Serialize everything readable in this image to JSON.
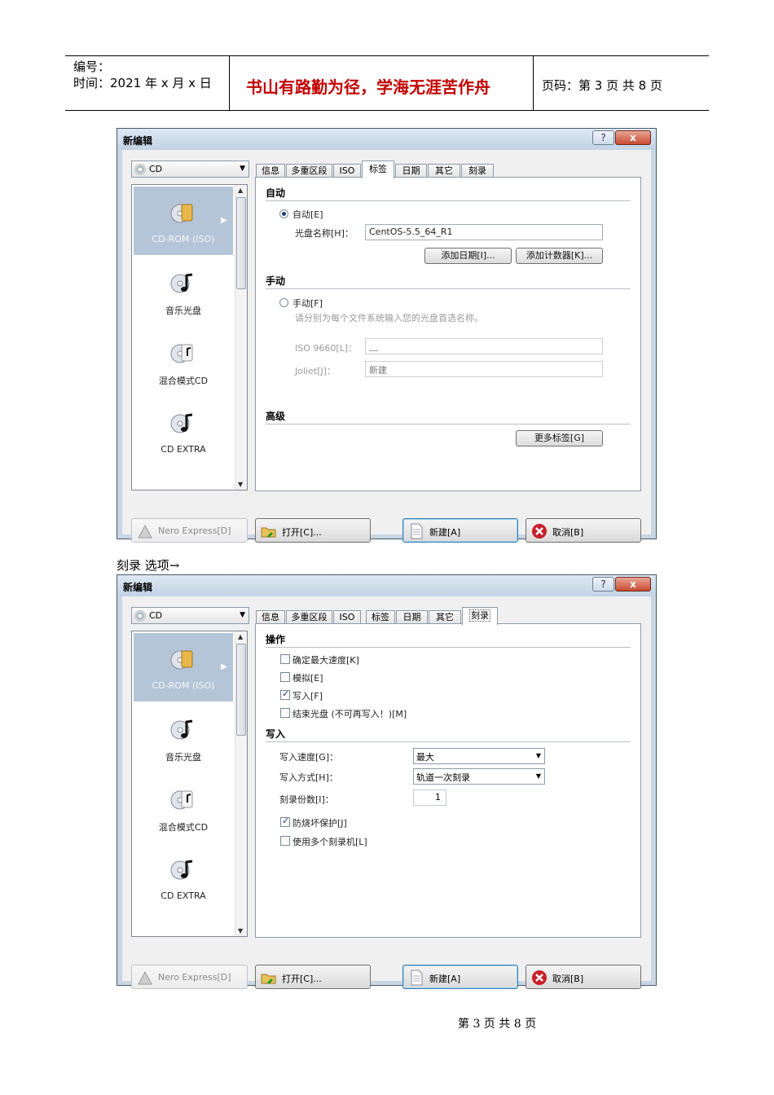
{
  "header": {
    "number_label": "编号：",
    "time_label": "时间：2021 年 x 月 x 日",
    "motto": "书山有路勤为径，学海无涯苦作舟",
    "page_info": "页码：第 3 页 共 8 页"
  },
  "dialog1": {
    "title": "新编辑",
    "help": "?",
    "close": "x",
    "disc_type": "CD",
    "left_items": [
      "CD-ROM (ISO)",
      "音乐光盘",
      "混合模式CD",
      "CD EXTRA"
    ],
    "tabs": [
      "信息",
      "多重区段",
      "ISO",
      "标签",
      "日期",
      "其它",
      "刻录"
    ],
    "active_tab": "标签",
    "auto": {
      "section": "自动",
      "radio_label": "自动[E]",
      "disc_name_label": "光盘名称[H]：",
      "disc_name_value": "CentOS-5.5_64_R1",
      "add_date_button": "添加日期[I]...",
      "add_counter_button": "添加计数器[K]..."
    },
    "manual": {
      "section": "手动",
      "radio_label": "手动[F]",
      "hint": "请分别为每个文件系统输入您的光盘首选名称。",
      "iso_label": "ISO 9660[L]：",
      "iso_value": "__",
      "joliet_label": "Joliet[J]：",
      "joliet_value": "新建"
    },
    "advanced": {
      "section": "高级",
      "more_labels_button": "更多标签[G]"
    },
    "buttons": {
      "nero_express": "Nero Express[D]",
      "open": "打开[C]...",
      "new": "新建[A]",
      "cancel": "取消[B]"
    }
  },
  "caption": "刻录 选项→",
  "dialog2": {
    "title": "新编辑",
    "help": "?",
    "close": "x",
    "disc_type": "CD",
    "left_items": [
      "CD-ROM (ISO)",
      "音乐光盘",
      "混合模式CD",
      "CD EXTRA"
    ],
    "tabs": [
      "信息",
      "多重区段",
      "ISO",
      "标签",
      "日期",
      "其它",
      "刻录"
    ],
    "active_tab": "刻录",
    "operation": {
      "section": "操作",
      "checks": [
        {
          "label": "确定最大速度[K]",
          "checked": false
        },
        {
          "label": "模拟[E]",
          "checked": false
        },
        {
          "label": "写入[F]",
          "checked": true
        },
        {
          "label": "结束光盘 (不可再写入！)[M]",
          "checked": false
        }
      ]
    },
    "write": {
      "section": "写入",
      "speed_label": "写入速度[G]：",
      "speed_value": "最大",
      "method_label": "写入方式[H]：",
      "method_value": "轨道一次刻录",
      "copies_label": "刻录份数[I]：",
      "copies_value": "1",
      "checks": [
        {
          "label": "防烧坏保护[J]",
          "checked": true
        },
        {
          "label": "使用多个刻录机[L]",
          "checked": false
        }
      ]
    },
    "buttons": {
      "nero_express": "Nero Express[D]",
      "open": "打开[C]...",
      "new": "新建[A]",
      "cancel": "取消[B]"
    }
  },
  "footer": "第 3 页 共 8 页"
}
